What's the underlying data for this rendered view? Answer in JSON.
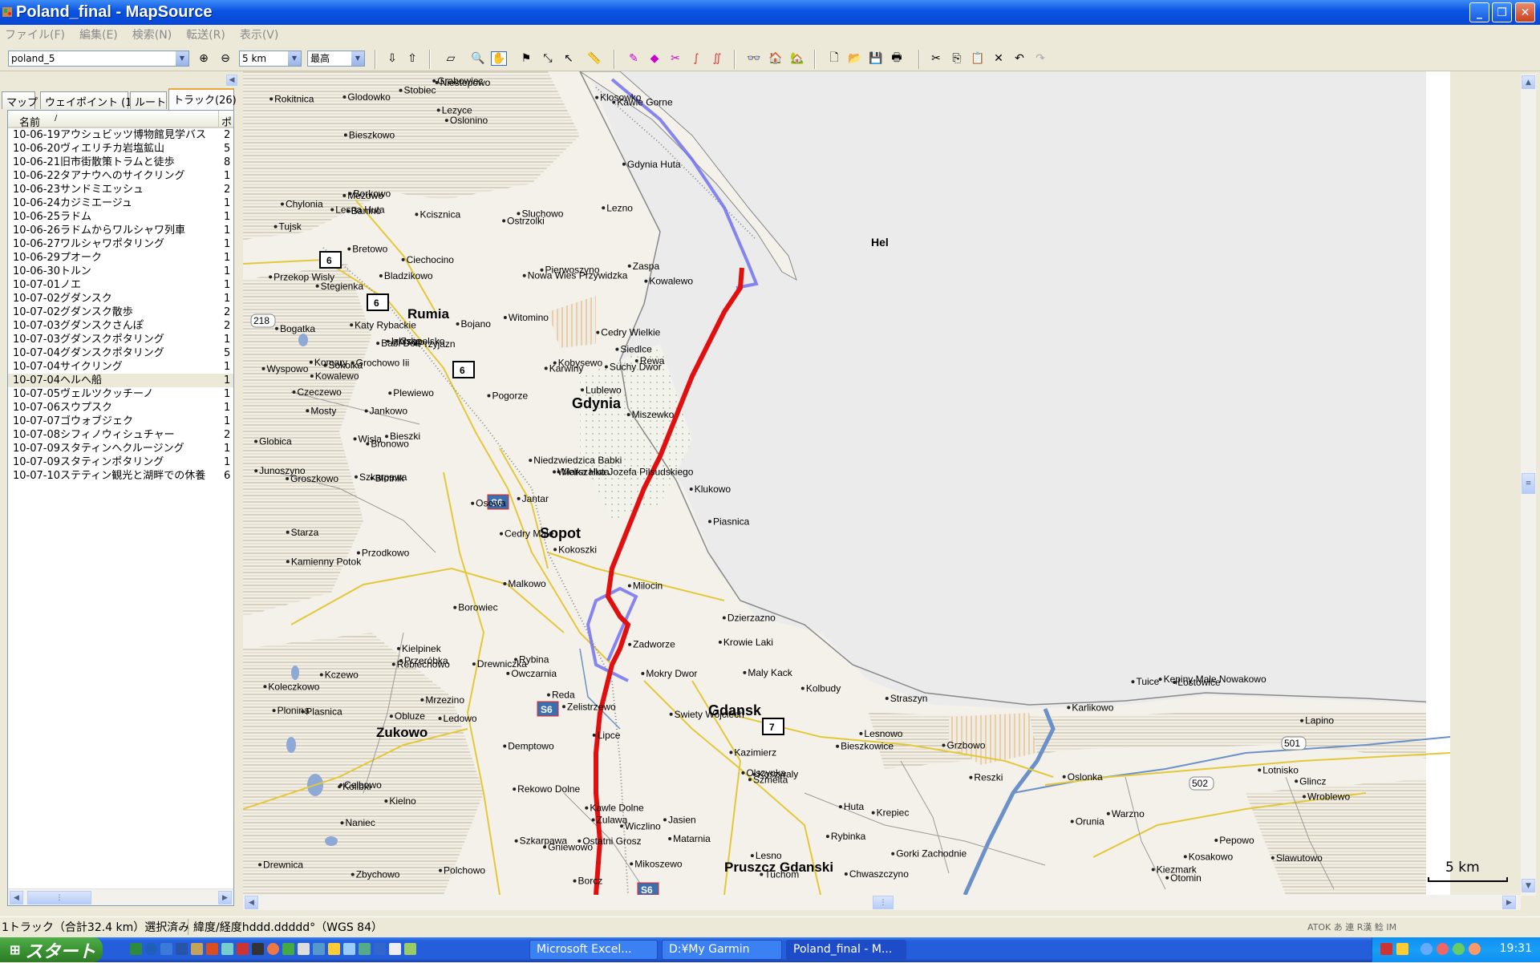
{
  "window": {
    "title": "Poland_final - MapSource",
    "minimize": "_",
    "maximize": "❐",
    "close": "✕"
  },
  "menu": [
    "ファイル(F)",
    "編集(E)",
    "検索(N)",
    "転送(R)",
    "表示(V)"
  ],
  "toolbar": {
    "map_product": "poland_5",
    "zoom_scale": "5 km",
    "detail_level": "最高"
  },
  "tabs": [
    "マップ",
    "ウェイポイント (1)",
    "ルート",
    "トラック(26)"
  ],
  "track_list": {
    "header_name": "名前",
    "header_sort": "/",
    "header_count": "ポ",
    "rows": [
      {
        "name": "10-06-19アウシュビッツ博物館見学バス",
        "count": "2"
      },
      {
        "name": "10-06-20ヴィエリチカ岩塩鉱山",
        "count": "5"
      },
      {
        "name": "10-06-21旧市街散策トラムと徒歩",
        "count": "8"
      },
      {
        "name": "10-06-22タアナウへのサイクリング",
        "count": "1"
      },
      {
        "name": "10-06-23サンドミエッシュ",
        "count": "2"
      },
      {
        "name": "10-06-24カジミエージュ",
        "count": "1"
      },
      {
        "name": "10-06-25ラドム",
        "count": "1"
      },
      {
        "name": "10-06-26ラドムからワルシャワ列車",
        "count": "1"
      },
      {
        "name": "10-06-27ワルシャワポタリング",
        "count": "1"
      },
      {
        "name": "10-06-29プオーク",
        "count": "1"
      },
      {
        "name": "10-06-30トルン",
        "count": "1"
      },
      {
        "name": "10-07-01ノエ",
        "count": "1"
      },
      {
        "name": "10-07-02グダンスク",
        "count": "1"
      },
      {
        "name": "10-07-02グダンスク散歩",
        "count": "2"
      },
      {
        "name": "10-07-03グダンスクさんぽ",
        "count": "2"
      },
      {
        "name": "10-07-03グダンスクポタリング",
        "count": "1"
      },
      {
        "name": "10-07-04グダンスクポタリング",
        "count": "5"
      },
      {
        "name": "10-07-04サイクリング",
        "count": "1"
      },
      {
        "name": "10-07-04ヘルへ船",
        "count": "1"
      },
      {
        "name": "10-07-05ヴェルツクッチーノ",
        "count": "1"
      },
      {
        "name": "10-07-06スウプスク",
        "count": "1"
      },
      {
        "name": "10-07-07ゴウォブジェク",
        "count": "1"
      },
      {
        "name": "10-07-08シフィノウィシュチャー",
        "count": "2"
      },
      {
        "name": "10-07-09スタティンへクルージング",
        "count": "1"
      },
      {
        "name": "10-07-09スタティンポタリング",
        "count": "1"
      },
      {
        "name": "10-07-10ステティン観光と湖畔での休養",
        "count": "6"
      }
    ],
    "selected_index": 18
  },
  "map": {
    "cities": [
      "Gdynia",
      "Sopot",
      "Gdansk",
      "Rumia",
      "Zukowo",
      "Pruszcz Gdanski",
      "Hel"
    ],
    "places": [
      "Bladzikowo",
      "Celbowo",
      "Zelistrzewo",
      "Oslonino",
      "Slawutowo",
      "Bieszki",
      "Piasnica",
      "Polchowo",
      "Mrzezino",
      "Rewa",
      "Naniec",
      "Rekowo Dolne",
      "Ciechocino",
      "Mosty",
      "Kazimierz",
      "Pierwoszyno",
      "Reda",
      "Kosakowo",
      "Lotnisko",
      "Suchy Dwor",
      "Pogorze",
      "Gniewowo",
      "Wyspowo",
      "Zbychowo",
      "Szmelta",
      "Obluze",
      "Chylonia",
      "Reszki",
      "Demptowo",
      "Lezyce",
      "Glodowko",
      "Bieszkowice",
      "Marszalka Jozefa Pilsudskiego",
      "Sokolka",
      "Witomino",
      "Grabowiec",
      "Koleczkowo",
      "Maly Kack",
      "Wiczlino",
      "Karwiny",
      "Kolibki",
      "Bieszkowo",
      "Bojano",
      "Kamienny Potok",
      "Huta",
      "Kielno",
      "Lesno",
      "Warzno",
      "Chwaszczyno",
      "Grzbowo",
      "Karlikowo",
      "Kowalewo",
      "Tuchom",
      "Osowa",
      "Klosowko",
      "Czeczewo",
      "Borowiec",
      "Owczarnia",
      "Kawle Dolne",
      "Miszewko",
      "Banino",
      "Klukowo",
      "Kawle Gorne",
      "Kczewo",
      "Rebiechowo",
      "Zaspa",
      "Malkowo",
      "Pepowo",
      "Matarnia",
      "Bretowo",
      "Przeróbka",
      "Gorki Zachodnie",
      "Kobysewo",
      "Lezno",
      "Kokoszki",
      "Kielpinek",
      "Siedlce",
      "Plewiewo",
      "Borkowo",
      "Jasien",
      "Orunia",
      "Olszynka",
      "Nowa Wies Przywidzka",
      "Komary",
      "Mikoszewo",
      "Jantar",
      "Junoszyno",
      "Katy Rybackie",
      "Dzierzazno",
      "Glincz",
      "Niestepowo",
      "Otomin",
      "Lostowice",
      "Krepiec",
      "Bogatka",
      "Ostatni Grosz",
      "Przekop Wisly",
      "Izbiska",
      "Stegienka",
      "Rybinka",
      "Grochowo Iii",
      "Mezowo",
      "Przyjazn",
      "Babi Dol",
      "Jankowo",
      "Lipce",
      "Mokry Dwor",
      "Koszwaly",
      "Blotnik",
      "Drewniczka",
      "Bronowo",
      "Globica",
      "Groszkowo",
      "Plonina",
      "Krowie Laki",
      "Lapino",
      "Lublewo",
      "Swiety Wojciech",
      "Ledowo",
      "Milocin",
      "Wisla",
      "Drewnica",
      "Szkarpawa",
      "Rybina",
      "Stobiec",
      "Oslonka",
      "Tujsk",
      "Borcz",
      "Rokitnica",
      "Cedry Male",
      "Niedzwiedzica Babki",
      "Szkarpawa",
      "Starza",
      "Czapelsko",
      "Kolbudy",
      "Straszyn",
      "Wroblewo",
      "Ostrzolki",
      "Zulawa",
      "Cedry Wielkie",
      "Kiezmark",
      "Zadworze",
      "Lesnowo",
      "Tuice",
      "Kepiny Male Nowakowo",
      "Plasnica",
      "Kowalewo",
      "Sluchowo",
      "Kcisznica",
      "Wielka Huta",
      "Gdynia Huta",
      "Lesna Huta",
      "Przodkowo"
    ],
    "road_labels": [
      "6",
      "6",
      "6",
      "7",
      "S6",
      "S6",
      "S6",
      "218",
      "501",
      "502"
    ],
    "scale": "5 km"
  },
  "status": {
    "selection": "1トラック（合計32.4 km）選択済み",
    "coord_format": "緯度/経度hddd.ddddd°（WGS 84）",
    "ime": "ATOK あ 連 R漢 鯰 ⅠM"
  },
  "taskbar": {
    "start": "スタート",
    "tasks": [
      "Microsoft Excel...",
      "D:¥My Garmin",
      "Poland_final - M..."
    ],
    "clock": "19:31"
  },
  "colors": {
    "route_track": "#e01010",
    "secondary_track": "#6a6af0",
    "titlebar": "#0a53e2",
    "sea": "#ebebeb",
    "highway_shield": "#3a6fb0"
  }
}
